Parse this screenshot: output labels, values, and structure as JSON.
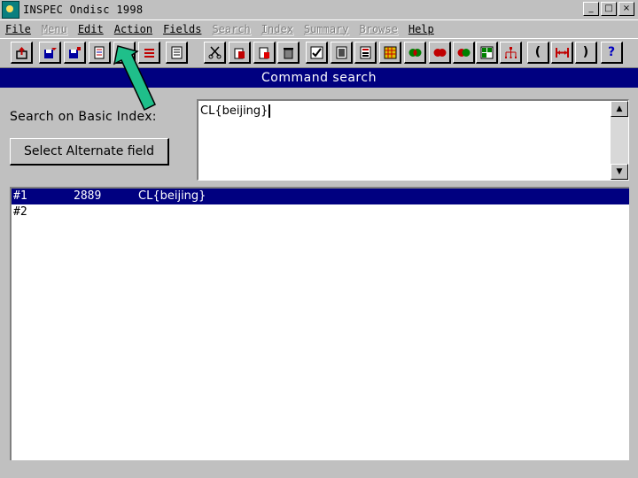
{
  "window": {
    "title": "INSPEC Ondisc 1998",
    "minimize": "_",
    "maximize": "□",
    "close": "×"
  },
  "menubar": [
    {
      "label": "File",
      "enabled": true
    },
    {
      "label": "Menu",
      "enabled": false
    },
    {
      "label": "Edit",
      "enabled": true
    },
    {
      "label": "Action",
      "enabled": true
    },
    {
      "label": "Fields",
      "enabled": true
    },
    {
      "label": "Search",
      "enabled": false
    },
    {
      "label": "Index",
      "enabled": false
    },
    {
      "label": "Summary",
      "enabled": false
    },
    {
      "label": "Browse",
      "enabled": false
    },
    {
      "label": "Help",
      "enabled": true
    }
  ],
  "toolbar": {
    "icons": [
      "export-icon",
      "send-icon",
      "save-icon",
      "list-icon",
      "tag-icon",
      "lines-icon",
      "page-icon",
      "cut-icon",
      "paste-icon",
      "clipboard-icon",
      "trash-icon",
      "check-icon",
      "doc-icon",
      "doc2-icon",
      "grid-icon",
      "venn-and-icon",
      "venn-or-icon",
      "venn-not-icon",
      "table-icon",
      "tree-icon"
    ],
    "open_paren": "(",
    "range_icon": "|↔|",
    "close_paren": ")",
    "help": "?"
  },
  "command_header": "Command search",
  "search": {
    "label": "Search on Basic Index:",
    "alt_button": "Select Alternate field",
    "query": "CL{beijing}"
  },
  "results": [
    {
      "num": "#1",
      "count": "2889",
      "query": "CL{beijing}",
      "selected": true
    },
    {
      "num": "#2",
      "count": "",
      "query": "",
      "selected": false
    }
  ],
  "colors": {
    "accent": "#000080",
    "annotation_arrow": "#1fbf8a"
  }
}
